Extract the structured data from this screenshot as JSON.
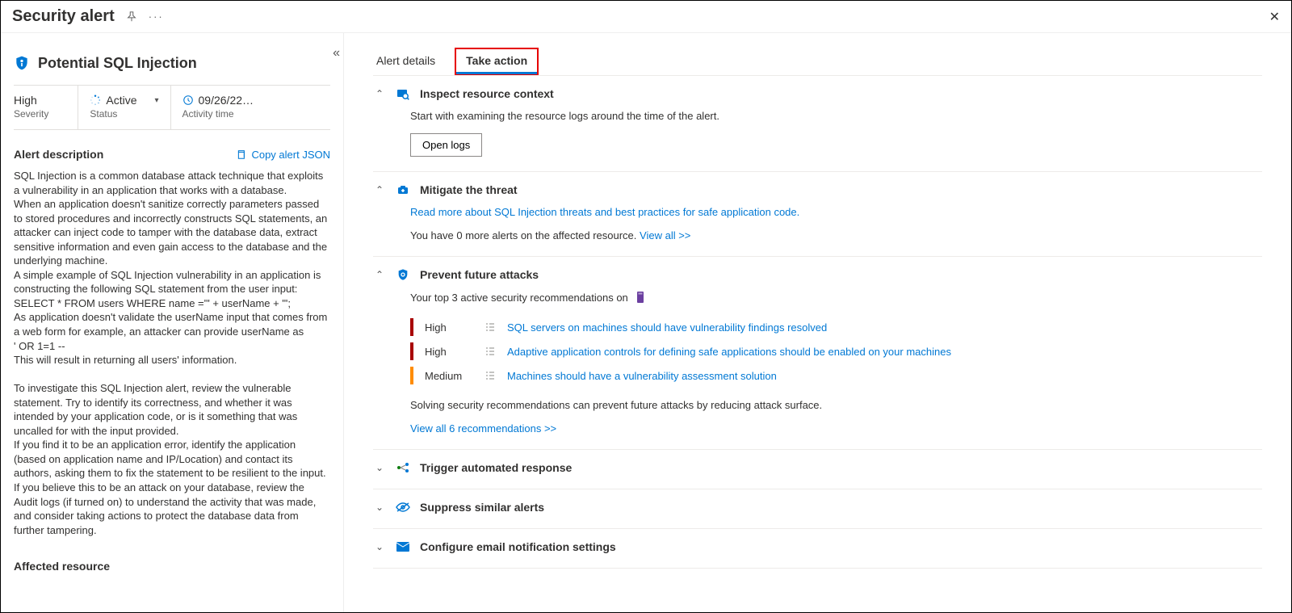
{
  "header": {
    "title": "Security alert"
  },
  "alert": {
    "title": "Potential SQL Injection",
    "severity": {
      "value": "High",
      "label": "Severity"
    },
    "status": {
      "value": "Active",
      "label": "Status"
    },
    "activity": {
      "value": "09/26/22…",
      "label": "Activity time"
    }
  },
  "description": {
    "heading": "Alert description",
    "copy_link": "Copy alert JSON",
    "body": "SQL Injection is a common database attack technique that exploits a vulnerability in an application that works with a database.\nWhen an application doesn't sanitize correctly parameters passed to stored procedures and incorrectly constructs SQL statements, an attacker can inject code to tamper with the database data, extract sensitive information and even gain access to the database and the underlying machine.\nA simple example of SQL Injection vulnerability in an application is constructing the following SQL statement from the user input:\nSELECT * FROM users WHERE name ='\" + userName + \"';\nAs application doesn't validate the userName input that comes from a web form for example, an attacker can provide userName as\n' OR 1=1 --\nThis will result in returning all users' information.\n\nTo investigate this SQL Injection alert, review the vulnerable statement. Try to identify its correctness, and whether it was intended by your application code, or is it something that was uncalled for with the input provided.\nIf you find it to be an application error, identify the application (based on application name and IP/Location) and contact its authors, asking them to fix the statement to be resilient to the input.\nIf you believe this to be an attack on your database, review the Audit logs (if turned on) to understand the activity that was made, and consider taking actions to protect the database data from further tampering."
  },
  "affected": {
    "heading": "Affected resource"
  },
  "tabs": {
    "details": "Alert details",
    "take_action": "Take action"
  },
  "actions": {
    "inspect": {
      "title": "Inspect resource context",
      "text": "Start with examining the resource logs around the time of the alert.",
      "button": "Open logs"
    },
    "mitigate": {
      "title": "Mitigate the threat",
      "link": "Read more about SQL Injection threats and best practices for safe application code.",
      "more_text": "You have 0 more alerts on the affected resource.",
      "view_all": "View all >>"
    },
    "prevent": {
      "title": "Prevent future attacks",
      "intro": "Your top 3 active security recommendations on",
      "recs": [
        {
          "severity": "High",
          "text": "SQL servers on machines should have vulnerability findings resolved"
        },
        {
          "severity": "High",
          "text": "Adaptive application controls for defining safe applications should be enabled on your machines"
        },
        {
          "severity": "Medium",
          "text": "Machines should have a vulnerability assessment solution"
        }
      ],
      "footer": "Solving security recommendations can prevent future attacks by reducing attack surface.",
      "view_all": "View all 6 recommendations >>"
    },
    "trigger": {
      "title": "Trigger automated response"
    },
    "suppress": {
      "title": "Suppress similar alerts"
    },
    "email": {
      "title": "Configure email notification settings"
    }
  }
}
